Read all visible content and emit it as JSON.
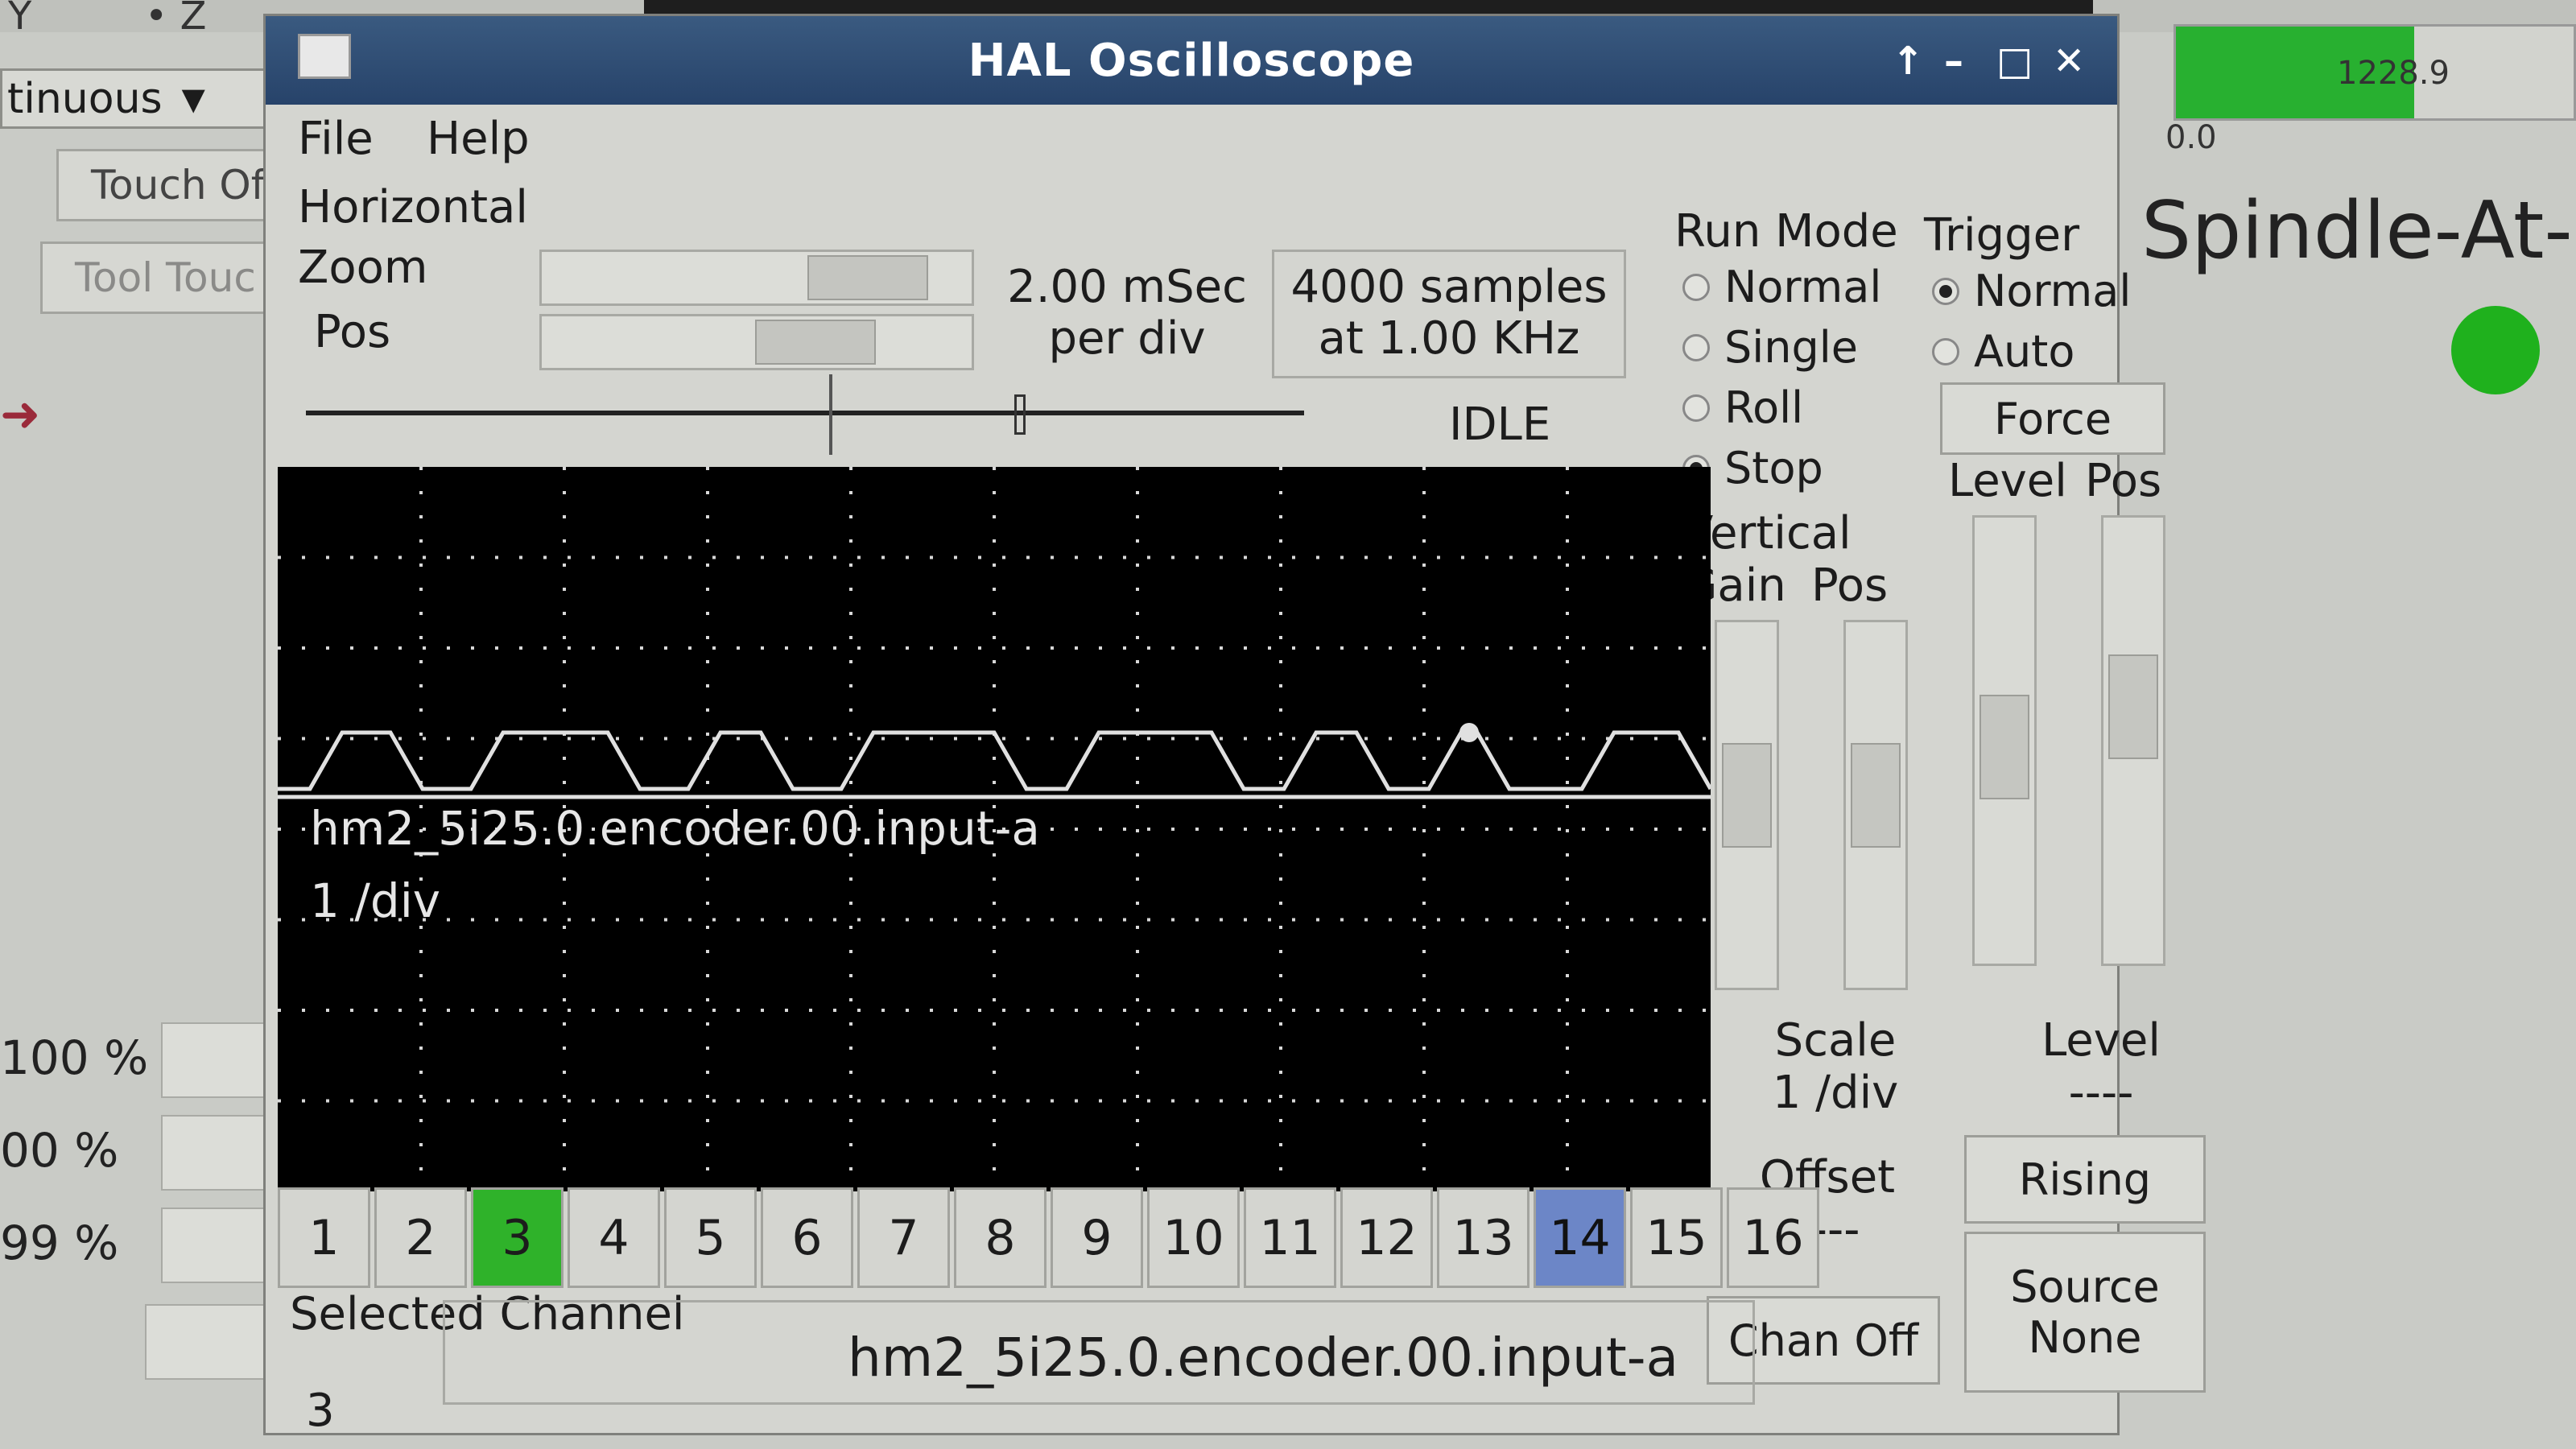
{
  "background": {
    "top_axes": [
      "Y",
      "Z"
    ],
    "mode_select": "tinuous",
    "touch_off_label": "Touch Off",
    "tool_touch_label": "Tool Touc",
    "percentages": [
      "100 %",
      "00 %",
      "99 %"
    ],
    "spindle_bar_min": "0.0",
    "spindle_bar_value": "1228.9",
    "spindle_at_speed_label": "Spindle-At-S",
    "spindle_led_color": "#1fb11d"
  },
  "window": {
    "title": "HAL Oscilloscope",
    "menu": [
      "File",
      "Help"
    ]
  },
  "horizontal": {
    "section_label": "Horizontal",
    "zoom_label": "Zoom",
    "pos_label": "Pos",
    "timebase_line1": "2.00 mSec",
    "timebase_line2": "per div",
    "samples_line1": "4000 samples",
    "samples_line2": "at 1.00 KHz",
    "status": "IDLE"
  },
  "run_mode": {
    "label": "Run Mode",
    "options": [
      "Normal",
      "Single",
      "Roll",
      "Stop"
    ],
    "selected": "Stop"
  },
  "trigger": {
    "label": "Trigger",
    "options": [
      "Normal",
      "Auto"
    ],
    "selected": "Normal",
    "force_label": "Force",
    "level_label": "Level",
    "pos_label": "Pos",
    "level_title": "Level",
    "level_value": "----",
    "edge_label": "Rising",
    "source_label": "Source",
    "source_value": "None"
  },
  "vertical": {
    "label": "Vertical",
    "gain_label": "Gain",
    "pos_label": "Pos",
    "scale_label": "Scale",
    "scale_value": "1 /div",
    "offset_label": "Offset",
    "offset_value": "----",
    "chan_off_label": "Chan Off"
  },
  "scope": {
    "trace_name": "hm2_5i25.0.encoder.00.input-a",
    "trace_scale": "1 /div",
    "trace_color": "#e0e0e0",
    "grid_color": "#d8d8d8"
  },
  "channels": {
    "labels": [
      "1",
      "2",
      "3",
      "4",
      "5",
      "6",
      "7",
      "8",
      "9",
      "10",
      "11",
      "12",
      "13",
      "14",
      "15",
      "16"
    ],
    "active": "3",
    "active_color": "#2fb22a",
    "hover": "14"
  },
  "selected_channel": {
    "label": "Selected Channel",
    "number": "3",
    "name": "hm2_5i25.0.encoder.00.input-a"
  }
}
